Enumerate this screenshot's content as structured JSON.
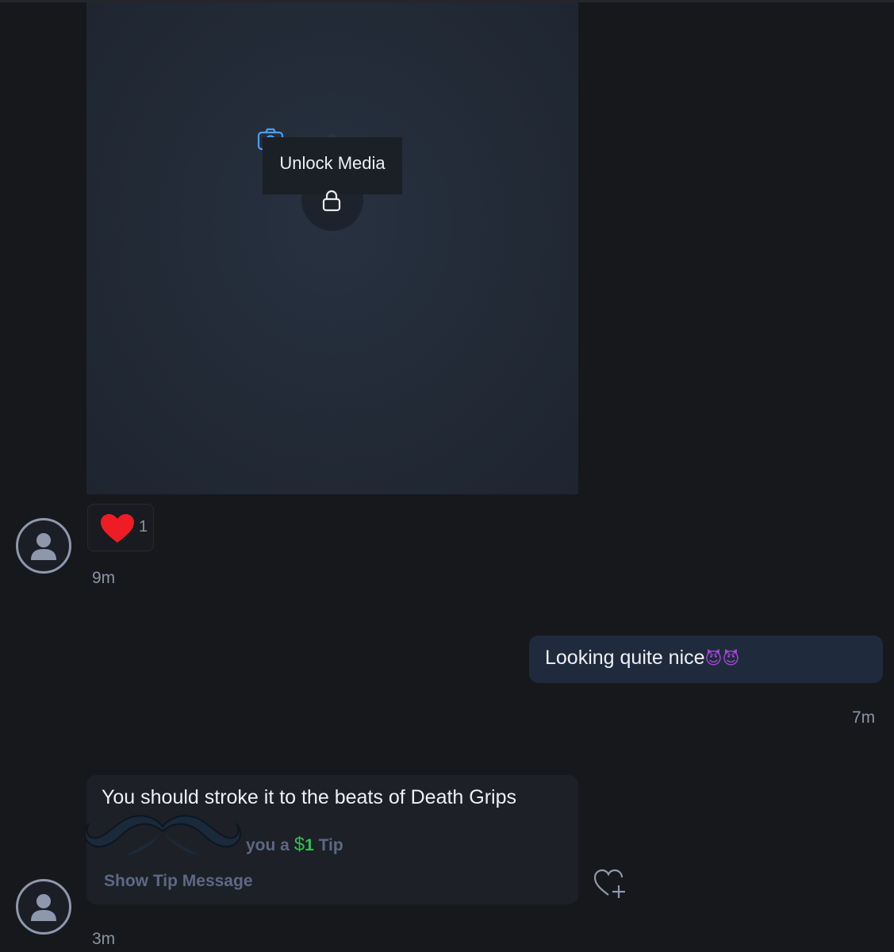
{
  "media_card": {
    "unlock_label": "Unlock Media",
    "camera_icon": "camera-icon",
    "lock_icon": "lock-icon"
  },
  "reaction": {
    "icon": "heart-icon",
    "count": "1"
  },
  "messages": [
    {
      "direction": "incoming",
      "time": "9m"
    },
    {
      "direction": "outgoing",
      "text": "Looking quite nice",
      "emoji": "😈😈",
      "time": "7m"
    },
    {
      "direction": "incoming",
      "text": "You should stroke it to the beats of Death Grips",
      "tip": {
        "prefix": "you a",
        "currency": "$",
        "amount": "1",
        "suffix": "Tip"
      },
      "show_tip_label": "Show Tip Message",
      "time": "3m"
    }
  ],
  "colors": {
    "background": "#17181c",
    "outgoing_bubble": "#1f2b3c",
    "incoming_bubble": "#1d2026",
    "tip_green": "#2fbe55",
    "heart_red": "#ee1c25",
    "accent_blue": "#4a9ff0"
  }
}
